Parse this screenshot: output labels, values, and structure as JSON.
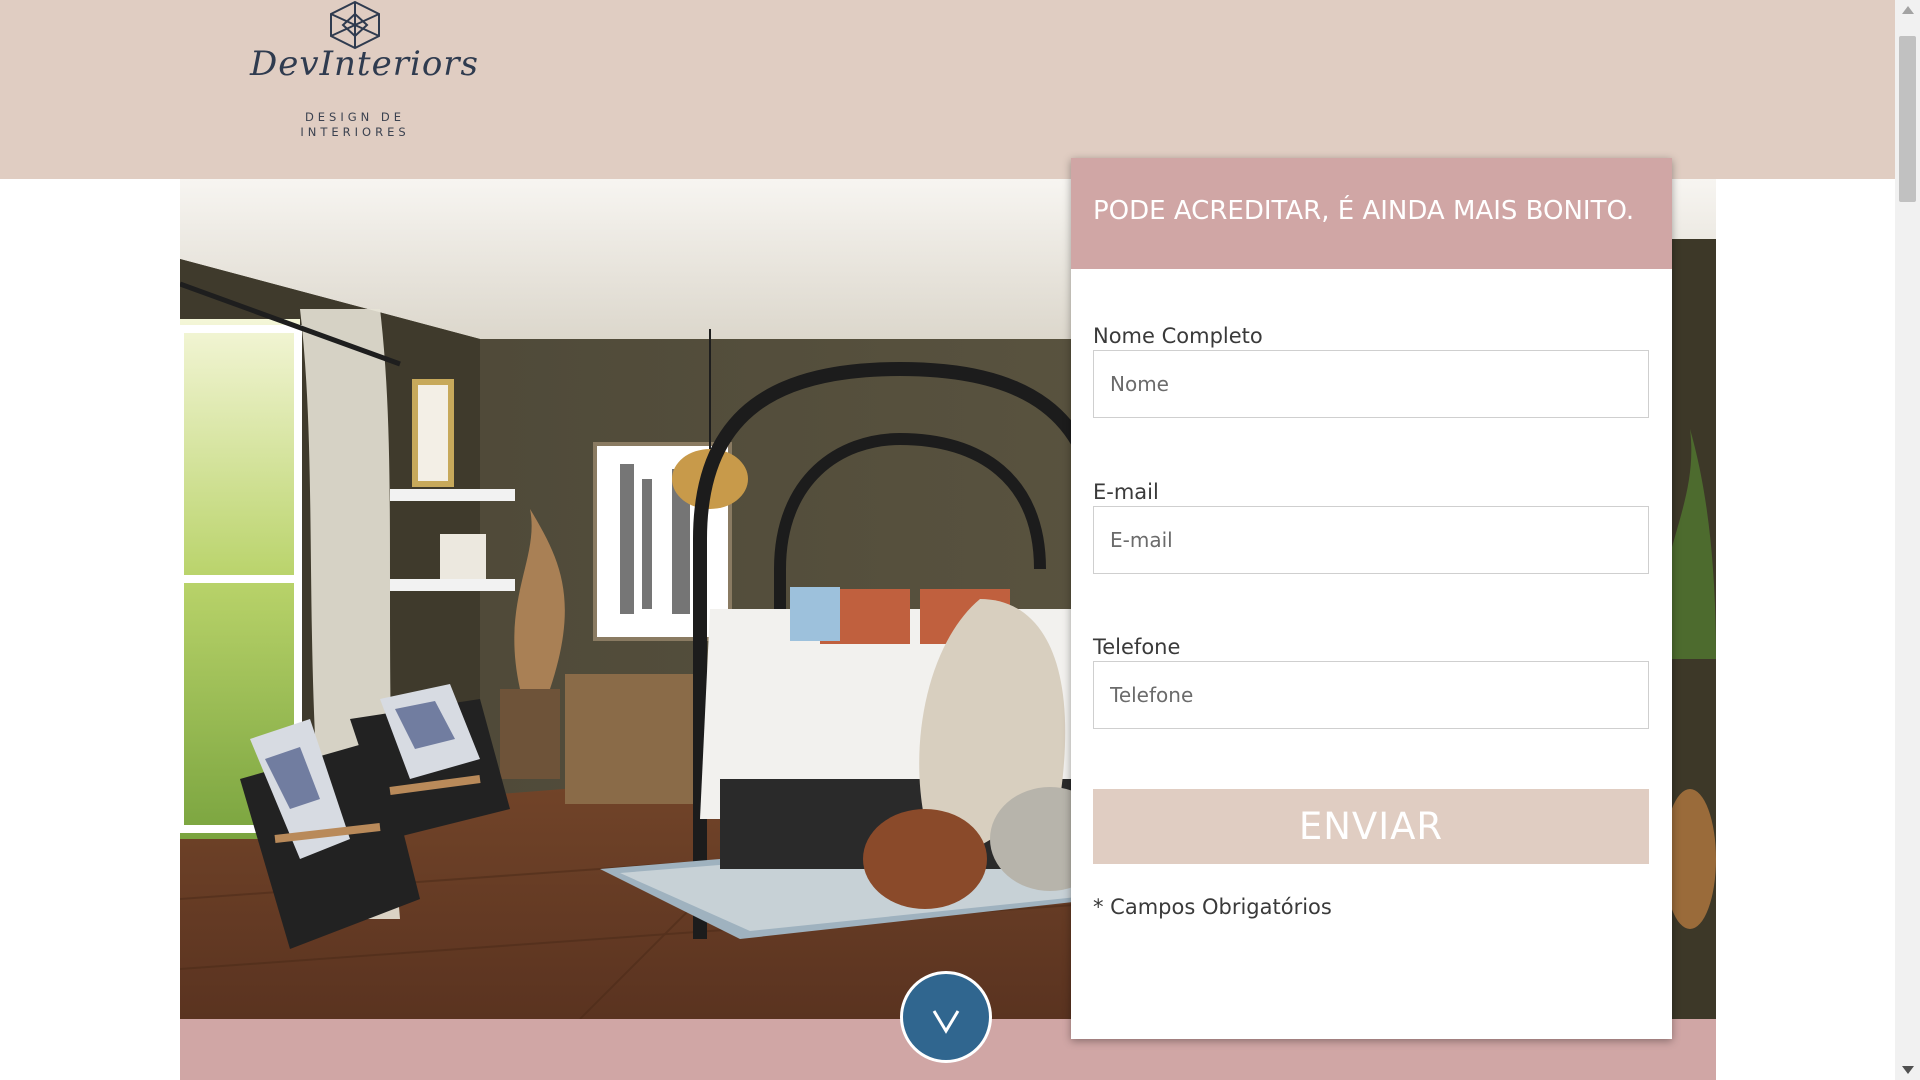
{
  "brand": {
    "name": "DevInteriors",
    "tagline_line1": "DESIGN DE",
    "tagline_line2": "INTERIORES"
  },
  "form": {
    "headline": "PODE ACREDITAR, É AINDA MAIS BONITO.",
    "fields": [
      {
        "label": "Nome Completo",
        "placeholder": "Nome",
        "value": ""
      },
      {
        "label": "E-mail",
        "placeholder": "E-mail",
        "value": ""
      },
      {
        "label": "Telefone",
        "placeholder": "Telefone",
        "value": ""
      }
    ],
    "submit_label": "ENVIAR",
    "required_note": "* Campos Obrigatórios"
  },
  "icons": {
    "logo": "geodesic-diamond-icon",
    "scroll_down": "chevron-down-icon"
  },
  "colors": {
    "header_bg": "#e0cdc2",
    "accent_pink": "#d0a6a5",
    "button_bg": "#e0cdc2",
    "down_button": "#30668f"
  }
}
